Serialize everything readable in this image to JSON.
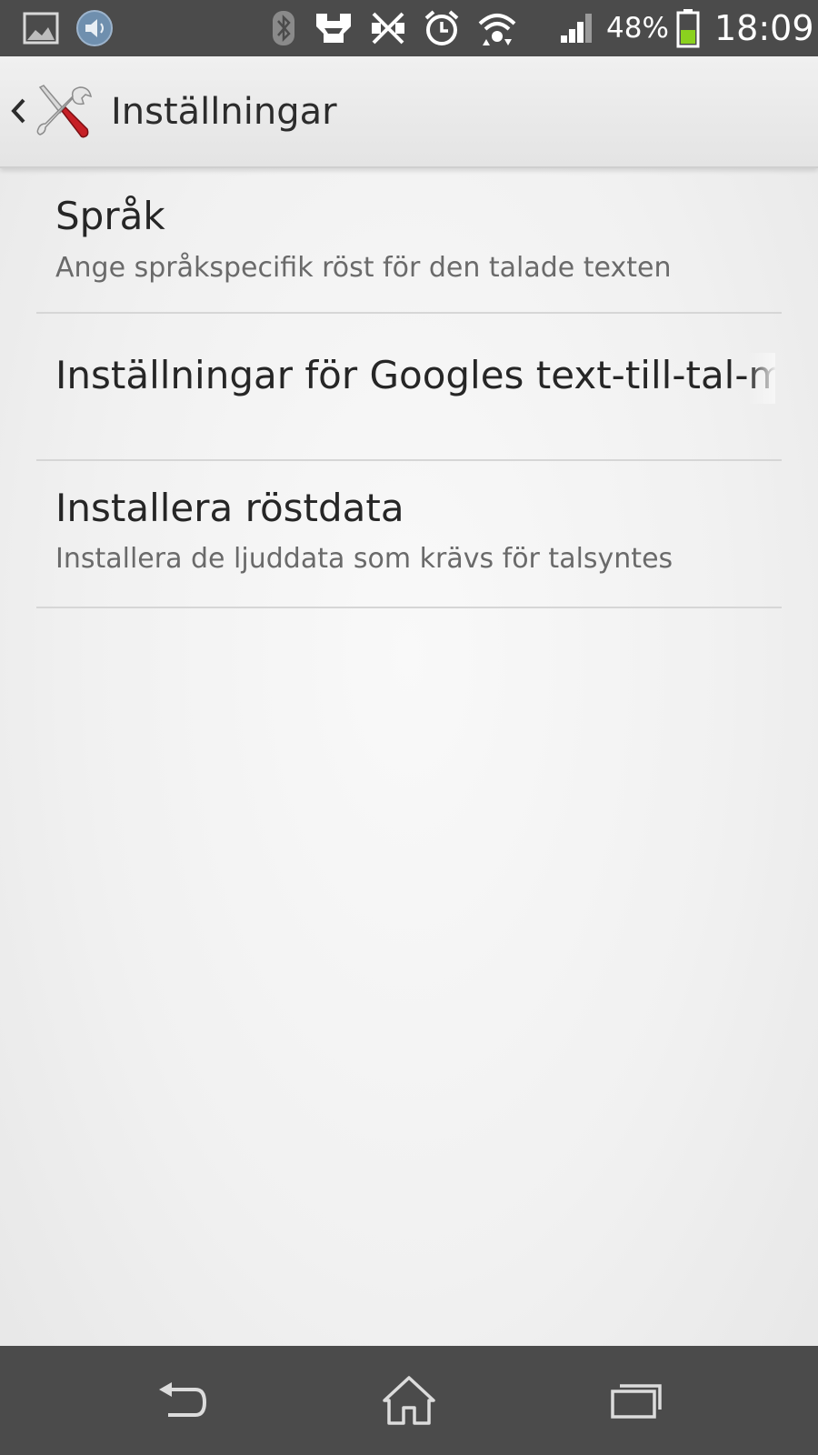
{
  "status_bar": {
    "left_icons": [
      "gallery-icon",
      "media-volume-icon"
    ],
    "right_icons": [
      "bluetooth-icon",
      "stamina-mode-icon",
      "nfc-off-icon",
      "alarm-icon",
      "wifi-icon",
      "cell-signal-icon",
      "battery-icon"
    ],
    "battery_percent": "48%",
    "battery_level": 0.48,
    "clock": "18:09"
  },
  "action_bar": {
    "up_icon": "chevron-left-icon",
    "app_icon": "settings-tools-icon",
    "title": "Inställningar"
  },
  "settings": [
    {
      "title": "Språk",
      "summary": "Ange språkspecifik röst för den talade texten"
    },
    {
      "title": "Inställningar för Googles text-till-tal-motor",
      "summary": ""
    },
    {
      "title": "Installera röstdata",
      "summary": "Installera de ljuddata som krävs för talsyntes"
    }
  ],
  "nav_bar": {
    "buttons": [
      "back-icon",
      "home-icon",
      "recent-apps-icon"
    ]
  },
  "colors": {
    "status_bar_bg": "#4b4b4b",
    "battery_fill": "#8bd11e",
    "icon_red": "#c62026"
  }
}
